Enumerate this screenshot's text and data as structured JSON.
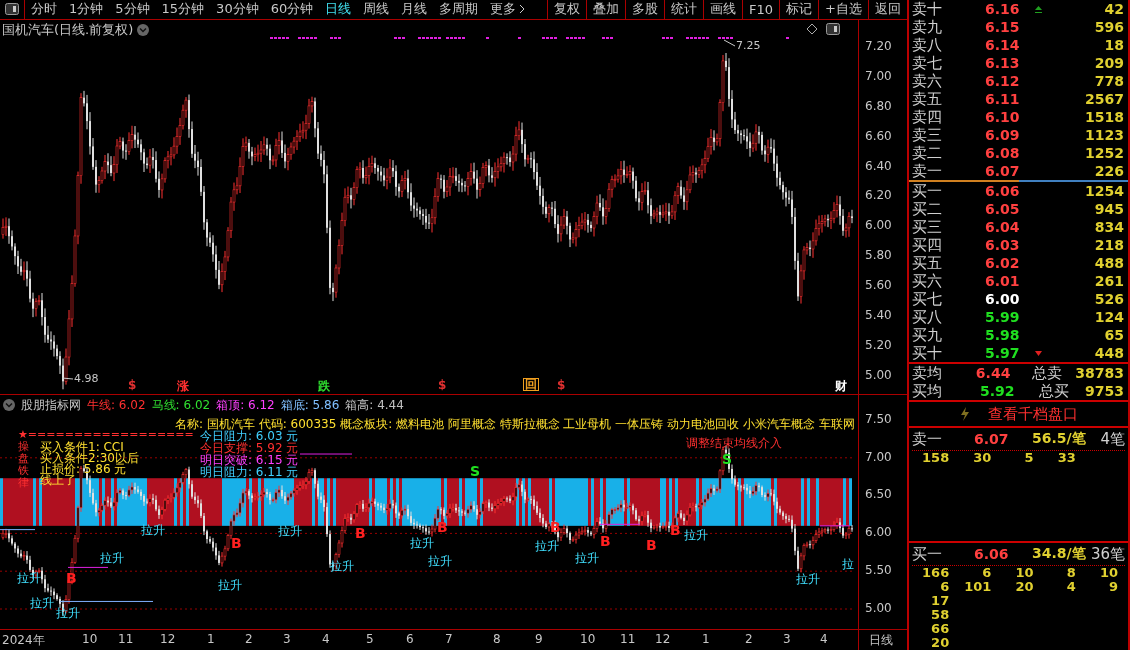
{
  "toolbar": {
    "tabs": [
      {
        "label": "分时",
        "selected": false
      },
      {
        "label": "1分钟",
        "selected": false
      },
      {
        "label": "5分钟",
        "selected": false
      },
      {
        "label": "15分钟",
        "selected": false
      },
      {
        "label": "30分钟",
        "selected": false
      },
      {
        "label": "60分钟",
        "selected": false
      },
      {
        "label": "日线",
        "selected": true
      },
      {
        "label": "周线",
        "selected": false
      },
      {
        "label": "月线",
        "selected": false
      },
      {
        "label": "多周期",
        "selected": false
      }
    ],
    "more": "更多",
    "buttons": [
      "复权",
      "叠加",
      "多股",
      "统计",
      "画线",
      "F10",
      "标记",
      "+自选",
      "返回"
    ]
  },
  "main_chart": {
    "title": "国机汽车(日线.前复权)",
    "y_axis": [
      "7.20",
      "7.00",
      "6.80",
      "6.60",
      "6.40",
      "6.20",
      "6.00",
      "5.80",
      "5.60",
      "5.40",
      "5.20",
      "5.00"
    ],
    "high_label": "7.25",
    "low_label": "4.98",
    "events": [
      {
        "text": "$",
        "color": "#e03030"
      },
      {
        "text": "涨",
        "color": "#ff3030"
      },
      {
        "text": "跌",
        "color": "#30e030"
      },
      {
        "text": "$",
        "color": "#e03030"
      },
      {
        "text": "回",
        "color": "#f0a020"
      },
      {
        "text": "$",
        "color": "#e03030"
      },
      {
        "text": "财",
        "color": "#ffffff"
      }
    ]
  },
  "indicator": {
    "name": "股朋指标网",
    "values": [
      {
        "label": "牛线:",
        "value": "6.02",
        "color": "#ff3030"
      },
      {
        "label": "马线:",
        "value": "6.02",
        "color": "#30e030"
      },
      {
        "label": "箱顶:",
        "value": "6.12",
        "color": "#ff40ff"
      },
      {
        "label": "箱底:",
        "value": "5.86",
        "color": "#80c0ff"
      },
      {
        "label": "箱高:",
        "value": "4.44",
        "color": "#c0c0c0"
      }
    ],
    "info": "名称: 国机汽车 代码: 600335 概念板块: 燃料电池 阿里概念 特斯拉概念 工业母机 一体压铸 动力电池回收 小米汽车概念 车联网",
    "levels": [
      {
        "text": "今日阻力:  6.03 元",
        "color": "#40d0ff"
      },
      {
        "text": "今日支撑:  5.92 元",
        "color": "#ff3030"
      },
      {
        "text": "明日突破:  6.15 元",
        "color": "#ff40ff"
      },
      {
        "text": "明日阻力:  6.11 元",
        "color": "#40d0ff"
      }
    ],
    "side_title": "操盘铁律",
    "rule": "★==================",
    "notes": [
      "买入条件1: CCI",
      "买入条件2:30以后",
      "止损价: 5.86 元",
      "线上了"
    ],
    "signal_text": "调整结束均线介入",
    "labels": [
      {
        "kind": "rise",
        "text": "拉升"
      },
      {
        "kind": "rise",
        "text": "拉升"
      },
      {
        "kind": "rise",
        "text": "拉升"
      },
      {
        "kind": "buy",
        "text": "B"
      },
      {
        "kind": "rise",
        "text": "拉升"
      },
      {
        "kind": "rise",
        "text": "拉升"
      },
      {
        "kind": "rise",
        "text": "拉升"
      },
      {
        "kind": "buy",
        "text": "B"
      },
      {
        "kind": "rise",
        "text": "拉升"
      },
      {
        "kind": "rise",
        "text": "拉升"
      },
      {
        "kind": "buy",
        "text": "B"
      },
      {
        "kind": "rise",
        "text": "拉升"
      },
      {
        "kind": "rise",
        "text": "拉升"
      },
      {
        "kind": "buy",
        "text": "B"
      },
      {
        "kind": "sell",
        "text": "S"
      },
      {
        "kind": "rise",
        "text": "拉升"
      },
      {
        "kind": "buy",
        "text": "B"
      },
      {
        "kind": "rise",
        "text": "拉升"
      },
      {
        "kind": "buy",
        "text": "B"
      },
      {
        "kind": "buy",
        "text": "B"
      },
      {
        "kind": "buy",
        "text": "B"
      },
      {
        "kind": "rise",
        "text": "拉升"
      },
      {
        "kind": "sell",
        "text": "S"
      },
      {
        "kind": "rise",
        "text": "拉升"
      },
      {
        "kind": "rise",
        "text": "拉"
      }
    ],
    "y_axis": [
      "7.50",
      "7.00",
      "6.50",
      "6.00",
      "5.50",
      "5.00"
    ]
  },
  "date_axis": {
    "labels": [
      "2024年",
      "10",
      "11",
      "12",
      "1",
      "2",
      "3",
      "4",
      "5",
      "6",
      "7",
      "8",
      "9",
      "10",
      "11",
      "12",
      "1",
      "2",
      "3",
      "4"
    ],
    "period": "日线"
  },
  "order_book": {
    "asks": [
      {
        "label": "卖十",
        "price": "6.16",
        "color": "#ff4040",
        "volume": "42",
        "kind": "up"
      },
      {
        "label": "卖九",
        "price": "6.15",
        "color": "#ff4040",
        "volume": "596",
        "kind": "plain"
      },
      {
        "label": "卖八",
        "price": "6.14",
        "color": "#ff4040",
        "volume": "18",
        "kind": "plain"
      },
      {
        "label": "卖七",
        "price": "6.13",
        "color": "#ff4040",
        "volume": "209",
        "kind": "plain"
      },
      {
        "label": "卖六",
        "price": "6.12",
        "color": "#ff4040",
        "volume": "778",
        "kind": "plain"
      },
      {
        "label": "卖五",
        "price": "6.11",
        "color": "#ff4040",
        "volume": "2567",
        "kind": "plain"
      },
      {
        "label": "卖四",
        "price": "6.10",
        "color": "#ff4040",
        "volume": "1518",
        "kind": "plain"
      },
      {
        "label": "卖三",
        "price": "6.09",
        "color": "#ff4040",
        "volume": "1123",
        "kind": "plain"
      },
      {
        "label": "卖二",
        "price": "6.08",
        "color": "#ff4040",
        "volume": "1252",
        "kind": "plain"
      },
      {
        "label": "卖一",
        "price": "6.07",
        "color": "#ff4040",
        "volume": "226",
        "kind": "plain"
      }
    ],
    "bids": [
      {
        "label": "买一",
        "price": "6.06",
        "color": "#ff4040",
        "volume": "1254",
        "kind": "plain"
      },
      {
        "label": "买二",
        "price": "6.05",
        "color": "#ff4040",
        "volume": "945",
        "kind": "plain"
      },
      {
        "label": "买三",
        "price": "6.04",
        "color": "#ff4040",
        "volume": "834",
        "kind": "plain"
      },
      {
        "label": "买四",
        "price": "6.03",
        "color": "#ff4040",
        "volume": "218",
        "kind": "plain"
      },
      {
        "label": "买五",
        "price": "6.02",
        "color": "#ff4040",
        "volume": "488",
        "kind": "plain"
      },
      {
        "label": "买六",
        "price": "6.01",
        "color": "#ff4040",
        "volume": "261",
        "kind": "plain"
      },
      {
        "label": "买七",
        "price": "6.00",
        "color": "#ffffff",
        "volume": "526",
        "kind": "plain"
      },
      {
        "label": "买八",
        "price": "5.99",
        "color": "#20e020",
        "volume": "124",
        "kind": "plain"
      },
      {
        "label": "买九",
        "price": "5.98",
        "color": "#20e020",
        "volume": "65",
        "kind": "plain"
      },
      {
        "label": "买十",
        "price": "5.97",
        "color": "#20e020",
        "volume": "448",
        "kind": "down"
      }
    ],
    "summary": [
      {
        "label": "卖均",
        "price": "6.44",
        "color": "#ff4040",
        "total_label": "总卖",
        "total": "38783"
      },
      {
        "label": "买均",
        "price": "5.92",
        "color": "#20e020",
        "total_label": "总买",
        "total": "9753"
      }
    ],
    "depth_link": "查看千档盘口",
    "best_ask": {
      "label": "卖一",
      "price": "6.07",
      "avg": "56.5/笔",
      "count": "4笔",
      "orders": [
        [
          "158",
          "30",
          "5",
          "33"
        ]
      ]
    },
    "best_bid": {
      "label": "买一",
      "price": "6.06",
      "avg": "34.8/笔",
      "count": "36笔",
      "orders": [
        [
          "166",
          "6",
          "10",
          "8",
          "10"
        ],
        [
          "6",
          "101",
          "20",
          "4",
          "9"
        ],
        [
          "17"
        ],
        [
          "58"
        ],
        [
          "66"
        ],
        [
          "20"
        ]
      ]
    }
  }
}
